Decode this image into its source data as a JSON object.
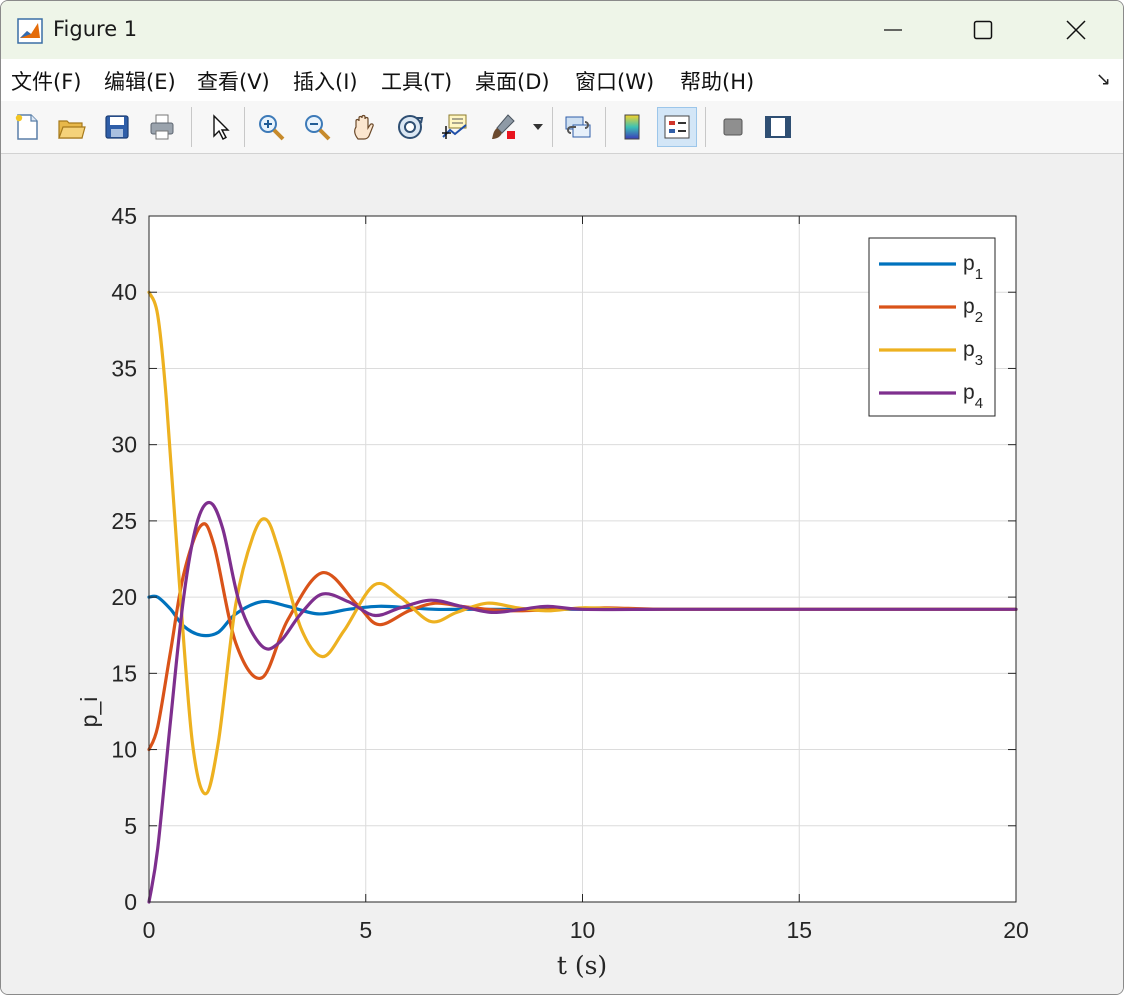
{
  "window": {
    "title": "Figure 1"
  },
  "menu": [
    "文件(F)",
    "编辑(E)",
    "查看(V)",
    "插入(I)",
    "工具(T)",
    "桌面(D)",
    "窗口(W)",
    "帮助(H)"
  ],
  "toolbar": [
    "new-figure-icon",
    "open-icon",
    "save-icon",
    "print-icon",
    "pointer-icon",
    "zoom-in-icon",
    "zoom-out-icon",
    "pan-icon",
    "rotate-3d-icon",
    "data-tips-icon",
    "brush-icon",
    "link-plot-icon",
    "colorbar-icon",
    "legend-icon",
    "hide-plot-tools-icon",
    "show-plot-tools-icon"
  ],
  "chart_data": {
    "type": "line",
    "title": "",
    "xlabel": "t (s)",
    "ylabel": "p_i",
    "xlim": [
      0,
      20
    ],
    "ylim": [
      0,
      45
    ],
    "xticks": [
      "0",
      "5",
      "10",
      "15",
      "20"
    ],
    "yticks": [
      "0",
      "5",
      "10",
      "15",
      "20",
      "25",
      "30",
      "35",
      "40",
      "45"
    ],
    "grid": true,
    "legend": "top-right",
    "series": [
      {
        "name": "p",
        "sub": "1",
        "color": "#0072BD",
        "x": [
          0,
          0.2,
          0.5,
          0.8,
          1.2,
          1.6,
          2.0,
          2.6,
          3.2,
          3.9,
          4.6,
          5.3,
          6.0,
          6.6,
          7.2,
          8.0,
          9.0,
          10.0,
          12.0,
          15.0,
          20.0
        ],
        "y": [
          20.0,
          20.0,
          19.2,
          18.1,
          17.5,
          17.7,
          18.9,
          19.7,
          19.4,
          18.9,
          19.2,
          19.4,
          19.3,
          19.2,
          19.2,
          19.2,
          19.2,
          19.2,
          19.2,
          19.2,
          19.2
        ]
      },
      {
        "name": "p",
        "sub": "2",
        "color": "#D95319",
        "x": [
          0,
          0.2,
          0.5,
          0.8,
          1.2,
          1.5,
          2.0,
          2.6,
          3.2,
          4.0,
          4.8,
          5.3,
          6.0,
          6.6,
          7.2,
          7.8,
          8.5,
          9.5,
          10.5,
          12.0,
          15.0,
          20.0
        ],
        "y": [
          10.0,
          11.5,
          16.5,
          21.5,
          24.7,
          23.4,
          17.0,
          14.7,
          18.5,
          21.6,
          19.5,
          18.2,
          19.1,
          19.6,
          19.4,
          19.2,
          19.1,
          19.2,
          19.3,
          19.2,
          19.2,
          19.2
        ]
      },
      {
        "name": "p",
        "sub": "3",
        "color": "#EDB120",
        "x": [
          0,
          0.2,
          0.4,
          0.7,
          1.0,
          1.3,
          1.6,
          2.0,
          2.4,
          2.7,
          3.0,
          3.5,
          4.0,
          4.5,
          5.2,
          5.8,
          6.5,
          7.1,
          7.8,
          8.5,
          9.2,
          10.0,
          11.0,
          12.0,
          13.0,
          15.0,
          20.0
        ],
        "y": [
          40.0,
          38.5,
          33.0,
          21.0,
          10.5,
          7.1,
          10.5,
          19.5,
          24.0,
          25.1,
          23.0,
          18.0,
          16.1,
          17.8,
          20.8,
          20.0,
          18.4,
          19.0,
          19.6,
          19.3,
          19.1,
          19.3,
          19.2,
          19.2,
          19.2,
          19.2,
          19.2
        ]
      },
      {
        "name": "p",
        "sub": "4",
        "color": "#7E2F8E",
        "x": [
          0,
          0.2,
          0.5,
          0.8,
          1.1,
          1.4,
          1.7,
          2.1,
          2.6,
          3.0,
          3.5,
          4.0,
          4.6,
          5.2,
          5.8,
          6.5,
          7.2,
          7.9,
          8.6,
          9.2,
          10.0,
          12.0,
          15.0,
          20.0
        ],
        "y": [
          0.0,
          3.5,
          12.0,
          20.0,
          24.8,
          26.2,
          24.5,
          19.5,
          16.8,
          17.0,
          18.9,
          20.2,
          19.7,
          18.8,
          19.3,
          19.8,
          19.4,
          19.0,
          19.2,
          19.4,
          19.2,
          19.2,
          19.2,
          19.2
        ]
      }
    ]
  }
}
